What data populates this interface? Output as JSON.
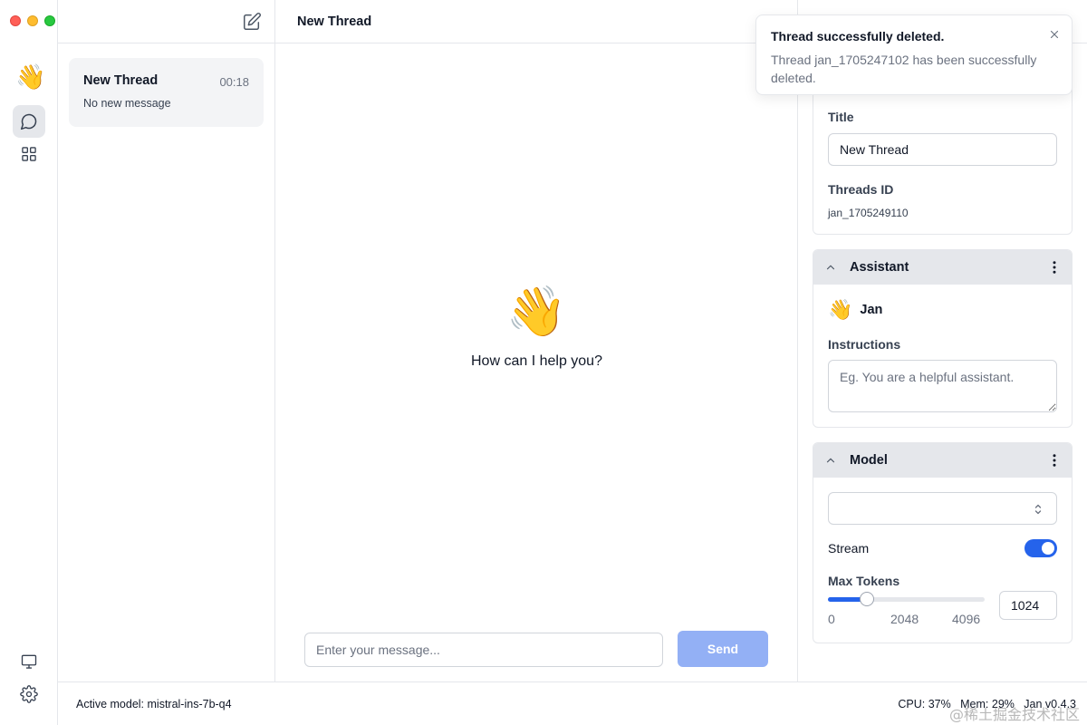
{
  "app": {
    "logo_emoji": "👋",
    "accent_color": "#2563eb"
  },
  "sidebar": {
    "icons": [
      "chat-icon",
      "grid-icon",
      "monitor-icon",
      "gear-icon"
    ]
  },
  "thread_list": {
    "threads": [
      {
        "title": "New Thread",
        "time": "00:18",
        "preview": "No new message"
      }
    ]
  },
  "main": {
    "title": "New Thread",
    "welcome_emoji": "👋",
    "welcome_text": "How can I help you?",
    "input_placeholder": "Enter your message...",
    "send_label": "Send"
  },
  "toast": {
    "title": "Thread successfully deleted.",
    "message": "Thread jan_1705247102 has been successfully deleted."
  },
  "thread_settings": {
    "title_label": "Title",
    "title_value": "New Thread",
    "id_label": "Threads ID",
    "id_value": "jan_1705249110"
  },
  "assistant": {
    "section_title": "Assistant",
    "emoji": "👋",
    "name": "Jan",
    "instructions_label": "Instructions",
    "instructions_placeholder": "Eg. You are a helpful assistant."
  },
  "model": {
    "section_title": "Model",
    "selected": "",
    "stream_label": "Stream",
    "stream_enabled": true,
    "max_tokens_label": "Max Tokens",
    "max_tokens_value": "1024",
    "max_tokens_min": "0",
    "max_tokens_mid": "2048",
    "max_tokens_max": "4096",
    "max_tokens_fraction": 0.25
  },
  "status": {
    "active_model": "Active model: mistral-ins-7b-q4",
    "system": "CPU: 37%   Mem: 29%   Jan v0.4.3",
    "watermark": "@稀土掘金技术社区"
  }
}
